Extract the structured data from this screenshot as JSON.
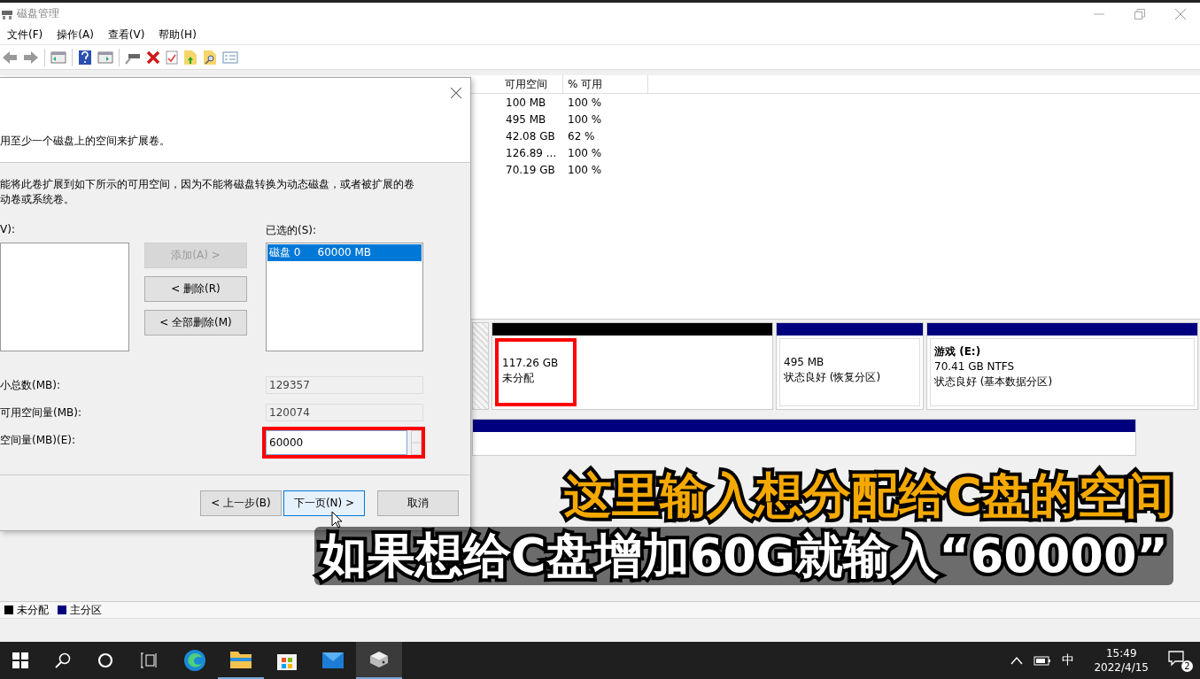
{
  "window": {
    "title": "磁盘管理"
  },
  "menu": [
    "文件(F)",
    "操作(A)",
    "查看(V)",
    "帮助(H)"
  ],
  "volume_table": {
    "columns": [
      "可用空间",
      "% 可用"
    ],
    "rows": [
      {
        "free": "100 MB",
        "percent": "100 %"
      },
      {
        "free": "495 MB",
        "percent": "100 %"
      },
      {
        "free": "42.08 GB",
        "percent": "62 %"
      },
      {
        "free": "126.89 ...",
        "percent": "100 %"
      },
      {
        "free": "70.19 GB",
        "percent": "100 %"
      }
    ]
  },
  "disk_map": {
    "partitions": [
      {
        "kind": "unallocated",
        "highlighted": true,
        "lines": [
          "117.26 GB",
          "未分配"
        ]
      },
      {
        "kind": "primary",
        "highlighted": false,
        "lines": [
          "495 MB",
          "状态良好 (恢复分区)"
        ]
      },
      {
        "kind": "primary",
        "highlighted": false,
        "name": "游戏  (E:)",
        "lines": [
          "70.41 GB NTFS",
          "状态良好 (基本数据分区)"
        ]
      }
    ]
  },
  "legend": [
    {
      "label": "未分配",
      "color": "#000000"
    },
    {
      "label": "主分区",
      "color": "#00007f"
    }
  ],
  "dialog": {
    "intro": "用至少一个磁盘上的空间来扩展卷。",
    "note_lines": [
      "能将此卷扩展到如下所示的可用空间，因为不能将磁盘转换为动态磁盘，或者被扩展的卷",
      "动卷或系统卷。"
    ],
    "available_label": "V):",
    "selected_label": "已选的(S):",
    "selected_items": [
      {
        "text": "磁盘 0     60000 MB",
        "selected": true
      }
    ],
    "move_buttons": [
      {
        "label": "添加(A) >",
        "disabled": true
      },
      {
        "label": "< 删除(R)",
        "disabled": false
      },
      {
        "label": "< 全部删除(M)",
        "disabled": false
      }
    ],
    "fields": [
      {
        "label": "小总数(MB):",
        "value": "129357",
        "kind": "readonly",
        "highlighted": false
      },
      {
        "label": "可用空间量(MB):",
        "value": "120074",
        "kind": "readonly",
        "highlighted": false
      },
      {
        "label": "空间量(MB)(E):",
        "value": "60000",
        "kind": "spinner",
        "highlighted": true
      }
    ],
    "buttons": [
      {
        "label": "< 上一步(B)",
        "focused": false
      },
      {
        "label": "下一页(N) >",
        "focused": true
      },
      {
        "label": "取消",
        "focused": false
      }
    ]
  },
  "captions": [
    {
      "text": "这里输入想分配给C盘的空间",
      "kind": "highlight"
    },
    {
      "text": "如果想给C盘增加60G就输入“60000”",
      "kind": "plain"
    }
  ],
  "taskbar": {
    "apps": [
      {
        "kind": "edge",
        "selected": false
      },
      {
        "kind": "explorer",
        "selected": false
      },
      {
        "kind": "store",
        "selected": false
      },
      {
        "kind": "mail",
        "selected": false
      },
      {
        "kind": "disk",
        "selected": true
      }
    ],
    "ime": "中",
    "time": "15:49",
    "date": "2022/4/15",
    "notifications": "2"
  }
}
